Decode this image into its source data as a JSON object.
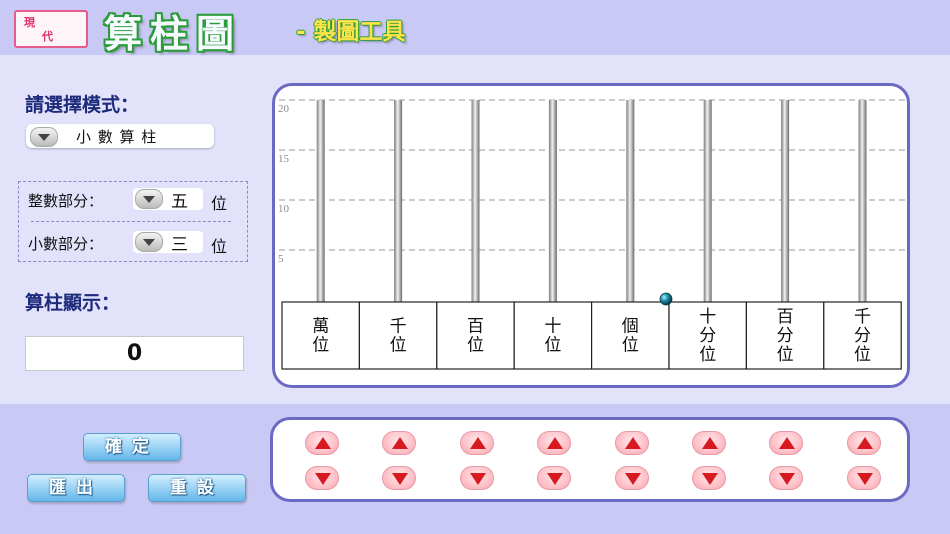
{
  "header": {
    "logo": "現代",
    "title": "算柱圖",
    "subtitle": "- 製圖工具"
  },
  "controls": {
    "mode_label": "請選擇模式：",
    "mode_value": "小 數 算 柱",
    "integer_label": "整數部分：",
    "integer_value": "五",
    "integer_unit": "位",
    "decimal_label": "小數部分：",
    "decimal_value": "三",
    "decimal_unit": "位",
    "display_label": "算柱顯示：",
    "display_value": "0"
  },
  "buttons": {
    "confirm": "確定",
    "export": "匯出",
    "reset": "重設"
  },
  "chart": {
    "y_ticks": [
      "20",
      "15",
      "10",
      "5"
    ],
    "places": [
      {
        "lines": [
          "萬",
          "位"
        ]
      },
      {
        "lines": [
          "千",
          "位"
        ]
      },
      {
        "lines": [
          "百",
          "位"
        ]
      },
      {
        "lines": [
          "十",
          "位"
        ]
      },
      {
        "lines": [
          "個",
          "位"
        ]
      },
      {
        "lines": [
          "十",
          "分",
          "位"
        ]
      },
      {
        "lines": [
          "百",
          "分",
          "位"
        ]
      },
      {
        "lines": [
          "千",
          "分",
          "位"
        ]
      }
    ],
    "counts": [
      0,
      0,
      0,
      0,
      0,
      0,
      0,
      0
    ]
  },
  "icons": {
    "decimal_point": "teal-bead",
    "increment": "red-up-triangle",
    "decrement": "red-down-triangle"
  }
}
